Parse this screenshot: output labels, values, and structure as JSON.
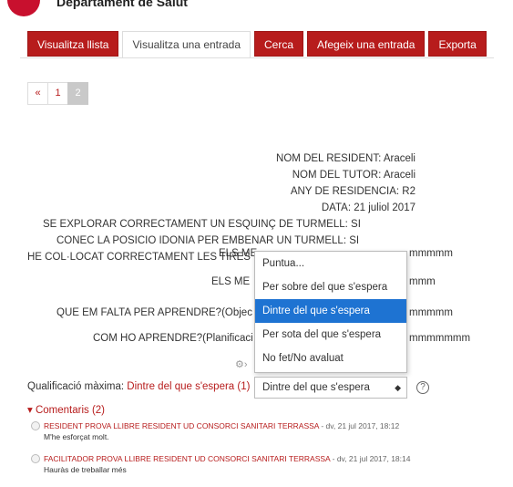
{
  "header": {
    "title": "Departament de Salut",
    "mark": "Salut"
  },
  "tabs": [
    {
      "label": "Visualitza llista",
      "active": false
    },
    {
      "label": "Visualitza una entrada",
      "active": true
    },
    {
      "label": "Cerca",
      "active": false
    },
    {
      "label": "Afegeix una entrada",
      "active": false
    },
    {
      "label": "Exporta",
      "active": false
    }
  ],
  "pagination": {
    "prev": "«",
    "pages": [
      "1",
      "2"
    ],
    "current": "2"
  },
  "fields": {
    "resident": "NOM DEL RESIDENT: Araceli",
    "tutor": "NOM DEL TUTOR: Araceli",
    "any": "ANY DE RESIDENCIA: R2",
    "data": "DATA: 21 juliol 2017",
    "explorar": "SE EXPLORAR CORRECTAMENT UN ESQUINÇ DE TURMELL: SI",
    "posicio": "CONEC LA POSICIO IDONIA PER EMBENAR UN TURMELL: SI",
    "tires": "HE COL·LOCAT CORRECTAMENT LES TIRES DE L'ANCORATGE: SI",
    "punts_forts_label": "ELS ME",
    "punts_forts_value": "mmmmm",
    "punts_febles_label": "ELS ME",
    "punts_febles_value": "mmm",
    "falta_label": "QUE EM FALTA PER APRENDRE?(Objec",
    "falta_value": "mmmmm",
    "com_label": "COM HO APRENDRE?(Planificaci",
    "com_value": "mmmmmmm"
  },
  "dropdown": {
    "options": [
      "Puntua...",
      "Per sobre del que s'espera",
      "Dintre del que s'espera",
      "Per sota del que s'espera",
      "No fet/No avaluat"
    ],
    "selected_index": 2
  },
  "rating": {
    "label": "Qualificació màxima: ",
    "value": "Dintre del que s'espera (1)",
    "select_value": "Dintre del que s'espera",
    "arrow": "◆"
  },
  "comments": {
    "toggle": "Comentaris (2)",
    "items": [
      {
        "author": "RESIDENT PROVA LLIBRE RESIDENT UD CONSORCI SANITARI TERRASSA",
        "meta": " - dv, 21 jul 2017, 18:12",
        "body": "M'he esforçat molt."
      },
      {
        "author": "FACILITADOR PROVA LLIBRE RESIDENT UD CONSORCI SANITARI TERRASSA",
        "meta": " - dv, 21 jul 2017, 18:14",
        "body": "Hauràs de treballar més"
      }
    ]
  },
  "colors": {
    "brand": "#b71c1c",
    "selected": "#1e73d2"
  }
}
